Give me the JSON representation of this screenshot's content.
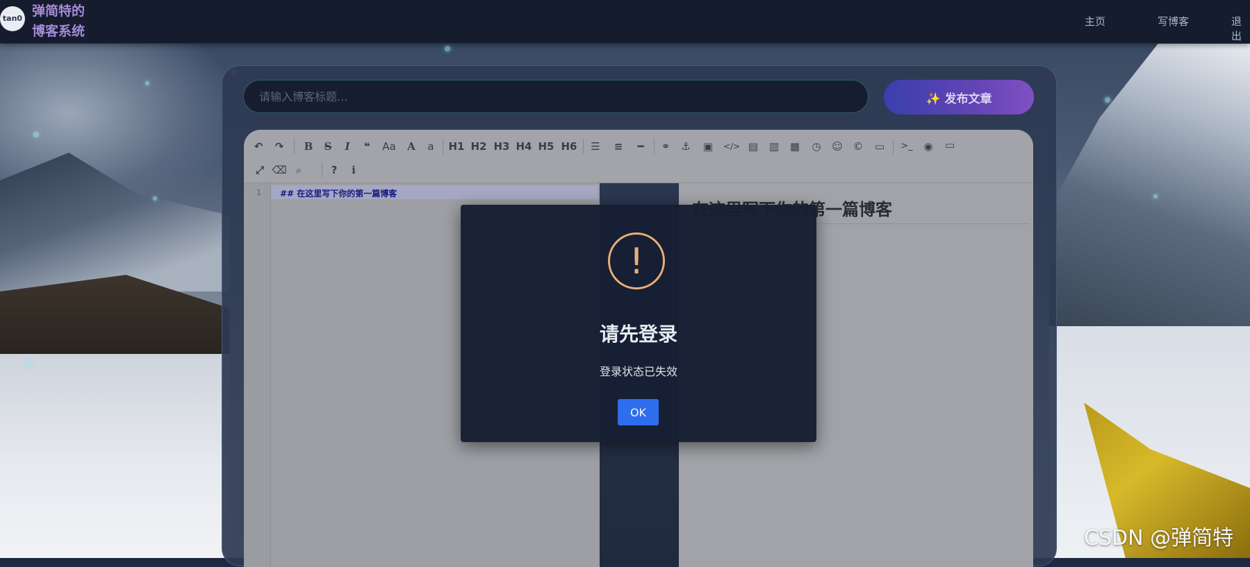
{
  "brand": {
    "logo_text": "tan0",
    "name_line1": "弹简特的",
    "name_line2": "博客系统"
  },
  "nav": {
    "items": [
      "主页",
      "写博客",
      "退出"
    ]
  },
  "editor": {
    "title_placeholder": "请输入博客标题...",
    "publish_label": "✨ 发布文章",
    "toolbar": {
      "row1": [
        "undo-icon",
        "redo-icon",
        "bold-icon",
        "strikethrough-icon",
        "italic-icon",
        "quote-icon",
        "uppercase-icon",
        "font-a-icon",
        "lowercase-icon",
        "H1",
        "H2",
        "H3",
        "H4",
        "H5",
        "H6",
        "unordered-list-icon",
        "ordered-list-icon",
        "hr-icon",
        "link-icon",
        "anchor-icon",
        "image-icon",
        "code-icon",
        "preformatted-icon",
        "code-block-icon",
        "table-icon",
        "datetime-icon",
        "emoji-icon",
        "html-entities-icon",
        "pagebreak-icon",
        "terminal-icon",
        "preview-toggle-icon",
        "fullpreview-icon"
      ],
      "row2": [
        "fullscreen-icon",
        "clear-icon",
        "search-icon",
        "help-icon",
        "info-icon"
      ]
    },
    "line_number": "1",
    "markdown_line": "## 在这里写下你的第一篇博客",
    "preview_heading": "在这里写下你的第一篇博客"
  },
  "modal": {
    "icon": "!",
    "title": "请先登录",
    "message": "登录状态已失效",
    "ok_label": "OK",
    "accent_color": "#f1b27a",
    "button_color": "#2f6ff3"
  },
  "watermark": "CSDN @弹简特"
}
